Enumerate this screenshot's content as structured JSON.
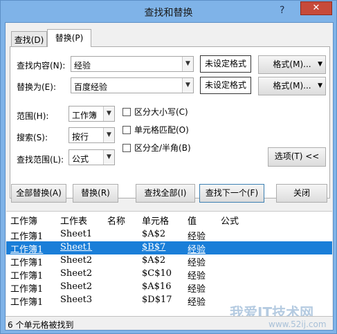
{
  "window": {
    "title": "查找和替换",
    "help": "?",
    "close": "✕"
  },
  "tabs": [
    {
      "label": "查找(D)"
    },
    {
      "label": "替换(P)"
    }
  ],
  "form": {
    "find_label": "查找内容(N):",
    "find_value": "经验",
    "replace_label": "替换为(E):",
    "replace_value": "百度经验",
    "format_unset_1": "未设定格式",
    "format_unset_2": "未设定格式",
    "format_btn_1": "格式(M)...",
    "format_btn_2": "格式(M)...",
    "scope_label": "范围(H):",
    "scope_value": "工作簿",
    "search_label": "搜索(S):",
    "search_value": "按行",
    "lookin_label": "查找范围(L):",
    "lookin_value": "公式",
    "match_case": "区分大小写(C)",
    "match_cell": "单元格匹配(O)",
    "match_width": "区分全/半角(B)",
    "options_btn": "选项(T) <<"
  },
  "actions": {
    "replace_all": "全部替换(A)",
    "replace": "替换(R)",
    "find_all": "查找全部(I)",
    "find_next": "查找下一个(F)",
    "close": "关闭"
  },
  "results": {
    "columns": [
      "工作簿",
      "工作表",
      "名称",
      "单元格",
      "值",
      "公式"
    ],
    "rows": [
      [
        "工作簿1",
        "Sheet1",
        "",
        "$A$2",
        "经验",
        ""
      ],
      [
        "工作簿1",
        "Sheet1",
        "",
        "$B$7",
        "经验",
        ""
      ],
      [
        "工作簿1",
        "Sheet2",
        "",
        "$A$2",
        "经验",
        ""
      ],
      [
        "工作簿1",
        "Sheet2",
        "",
        "$C$10",
        "经验",
        ""
      ],
      [
        "工作簿1",
        "Sheet2",
        "",
        "$A$16",
        "经验",
        ""
      ],
      [
        "工作簿1",
        "Sheet3",
        "",
        "$D$17",
        "经验",
        ""
      ]
    ],
    "selected_index": 1
  },
  "status": "6 个单元格被找到",
  "watermark": {
    "text": "我爱IT技术网",
    "url": "www.52ij.com"
  },
  "colors": {
    "selection": "#1a7ed8",
    "title_bar": "#7fb3e8",
    "close": "#c74a3a"
  }
}
